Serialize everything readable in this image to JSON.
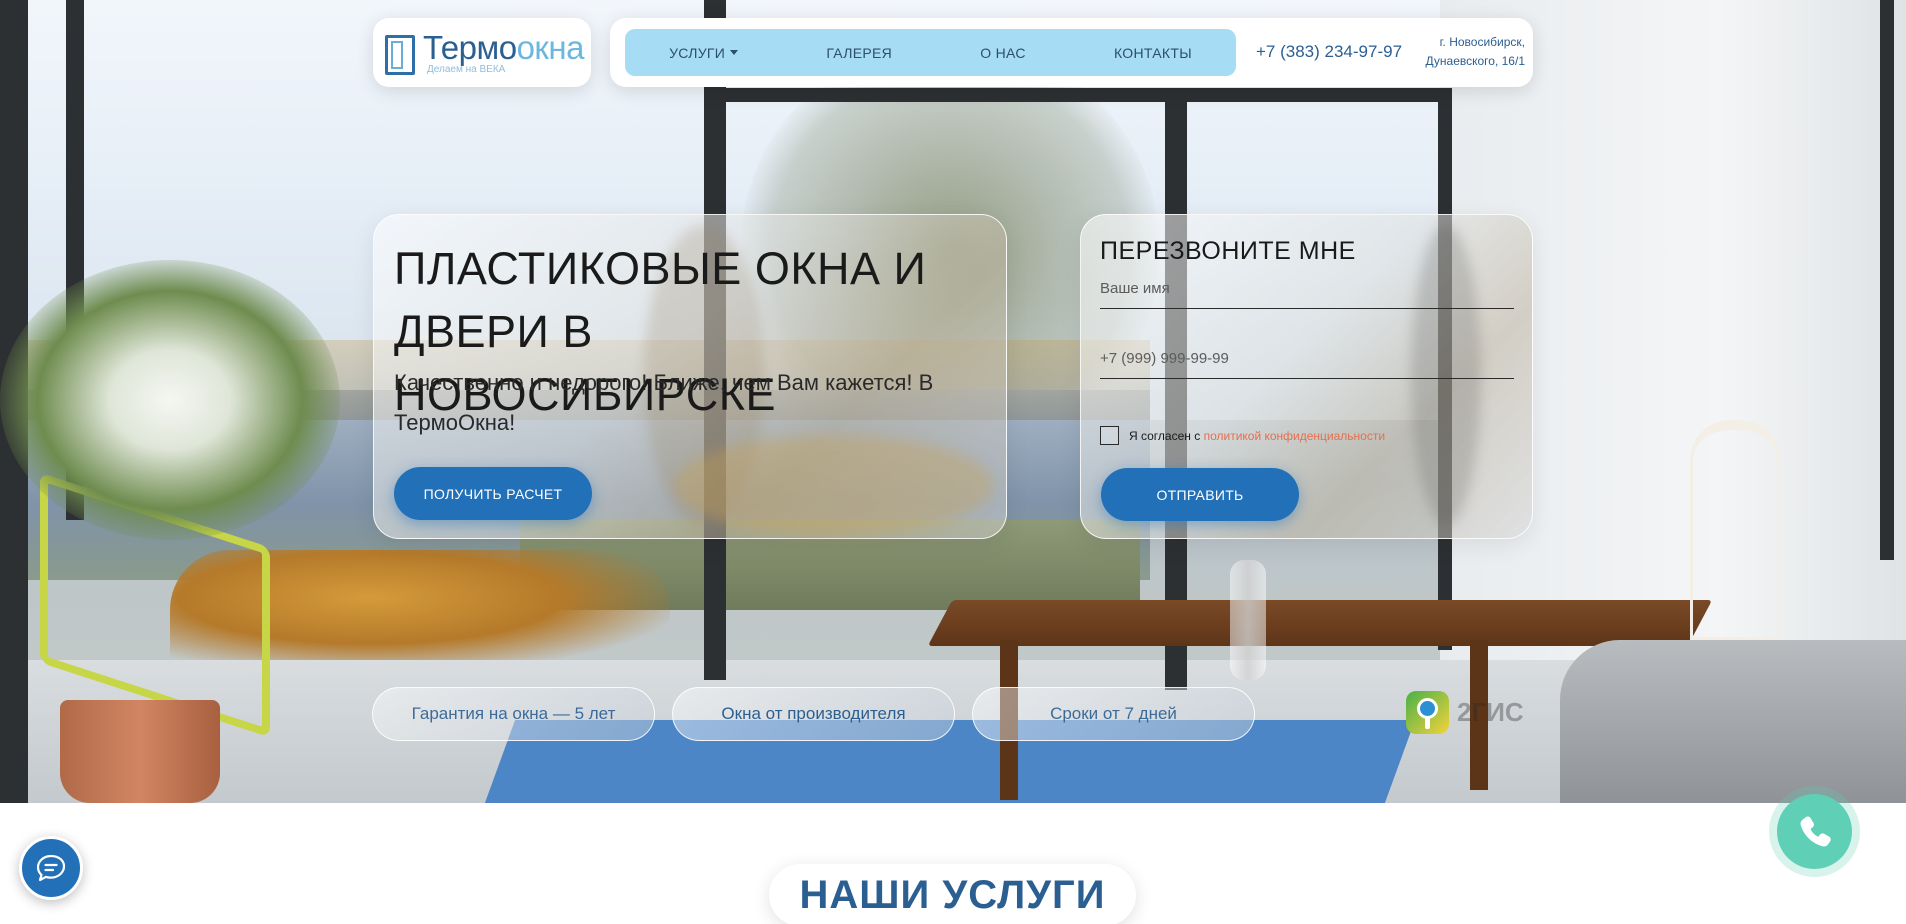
{
  "header": {
    "logo": {
      "name_part1": "Термо",
      "name_part2": "окна",
      "tagline": "Делаем на ВЕКА"
    },
    "nav": [
      {
        "label": "УСЛУГИ",
        "has_dropdown": true
      },
      {
        "label": "ГАЛЕРЕЯ"
      },
      {
        "label": "О НАС"
      },
      {
        "label": "КОНТАКТЫ"
      }
    ],
    "phone": "+7 (383) 234-97-97",
    "address_line1": "г. Новосибирск,",
    "address_line2": "Дунаевского, 16/1"
  },
  "hero": {
    "title": "ПЛАСТИКОВЫЕ ОКНА И ДВЕРИ В НОВОСИБИРСКЕ",
    "subtitle": "Качественно и недорого! Ближе, чем Вам кажется! В ТермоОкна!",
    "cta_label": "ПОЛУЧИТЬ РАСЧЕТ"
  },
  "callback_form": {
    "title": "ПЕРЕЗВОНИТЕ МНЕ",
    "name_placeholder": "Ваше имя",
    "phone_placeholder": "+7 (999) 999-99-99",
    "agree_text": "Я согласен с",
    "agree_link": "политикой конфиденциальности",
    "agree_checked": false,
    "submit_label": "ОТПРАВИТЬ"
  },
  "features": [
    {
      "label": "Гарантия на окна — 5 лет"
    },
    {
      "label": "Окна от производителя"
    },
    {
      "label": "Сроки от 7 дней"
    }
  ],
  "gis": {
    "text": "2ГИС",
    "icon": "2gis-pin-icon"
  },
  "section": {
    "title": "НАШИ УСЛУГИ"
  },
  "floating": {
    "chat_icon": "chat-bubble-icon",
    "call_icon": "phone-handset-icon"
  },
  "colors": {
    "accent": "#2270b8",
    "nav_bg": "#a7dcf5",
    "brand_dark": "#2b5f91",
    "brand_light": "#6cb7df",
    "call_button": "#5fcfb5",
    "link": "#e3704f"
  }
}
